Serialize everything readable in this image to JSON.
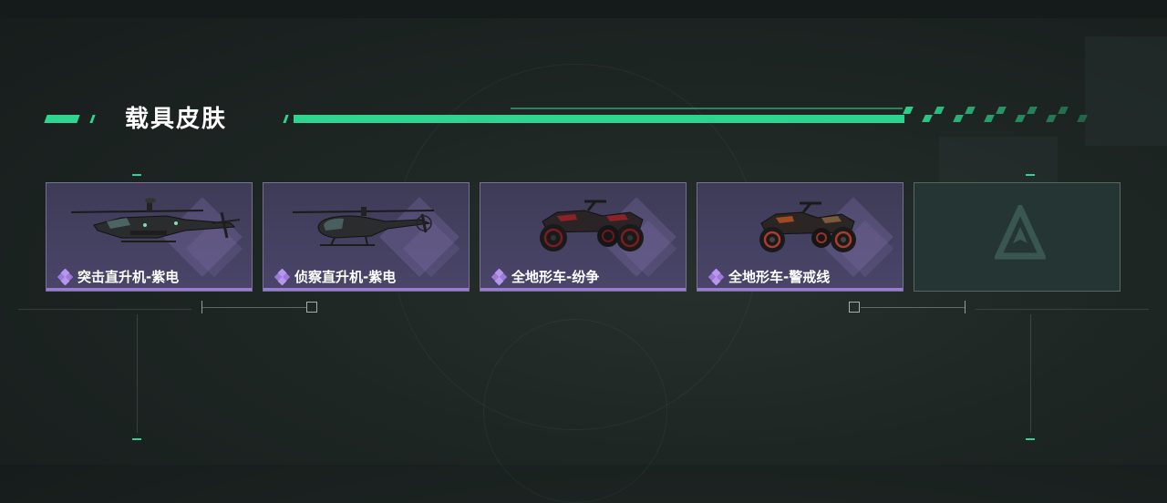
{
  "section": {
    "title": "载具皮肤"
  },
  "colors": {
    "accent_green": "#2fd58f",
    "card_purple": "#44405f",
    "rarity_purple": "#9c7ad8"
  },
  "skins": [
    {
      "name": "突击直升机-紫电",
      "vehicle_icon": "attack-helicopter",
      "rarity_icon": "purple-diamond-icon"
    },
    {
      "name": "侦察直升机-紫电",
      "vehicle_icon": "scout-helicopter",
      "rarity_icon": "purple-diamond-icon"
    },
    {
      "name": "全地形车-纷争",
      "vehicle_icon": "atv",
      "rarity_icon": "purple-diamond-icon"
    },
    {
      "name": "全地形车-警戒线",
      "vehicle_icon": "atv",
      "rarity_icon": "purple-diamond-icon"
    }
  ],
  "empty_slot": {
    "icon": "game-logo-placeholder-icon"
  }
}
